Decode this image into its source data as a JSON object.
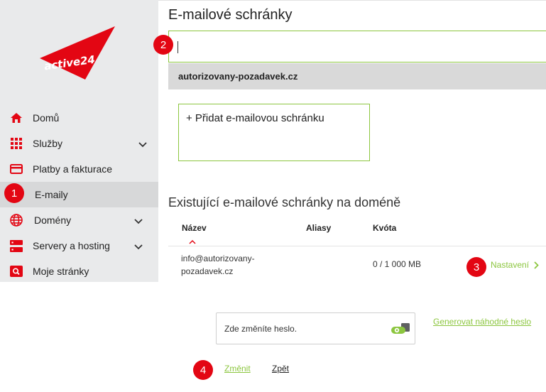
{
  "brand": {
    "logo_text": "active24",
    "accent": "#e30613",
    "link_color": "#8cc63f"
  },
  "sidebar": {
    "items": [
      {
        "label": "Domů",
        "icon": "home-icon",
        "expandable": false
      },
      {
        "label": "Služby",
        "icon": "grid-icon",
        "expandable": true
      },
      {
        "label": "Platby a fakturace",
        "icon": "credit-card-icon",
        "expandable": false
      },
      {
        "label": "E-maily",
        "icon": "",
        "expandable": false,
        "active": true
      },
      {
        "label": "Domény",
        "icon": "globe-icon",
        "expandable": true
      },
      {
        "label": "Servery a hosting",
        "icon": "server-icon",
        "expandable": true
      },
      {
        "label": "Moje stránky",
        "icon": "web-search-icon",
        "expandable": false
      }
    ]
  },
  "main": {
    "title": "E-mailové schránky",
    "search": {
      "value": "",
      "placeholder": ""
    },
    "domain": "autorizovany-pozadavek.cz",
    "add_mailbox_label": "+ Přidat e-mailovou schránku",
    "section_title": "Existující e-mailové schránky na doméně",
    "table": {
      "headers": {
        "name": "Název",
        "aliases": "Aliasy",
        "quota": "Kvóta"
      },
      "rows": [
        {
          "name_line1": "info@autorizovany-",
          "name_line2": "pozadavek.cz",
          "aliases": "",
          "quota": "0 / 1 000 MB",
          "action": "Nastavení"
        }
      ]
    },
    "password": {
      "placeholder_text": "Zde změníte heslo.",
      "generate_label": "Generovat náhodné heslo"
    },
    "actions": {
      "change_label": "Změnit",
      "back_label": "Zpět"
    }
  },
  "callouts": [
    "1",
    "2",
    "3",
    "4"
  ]
}
